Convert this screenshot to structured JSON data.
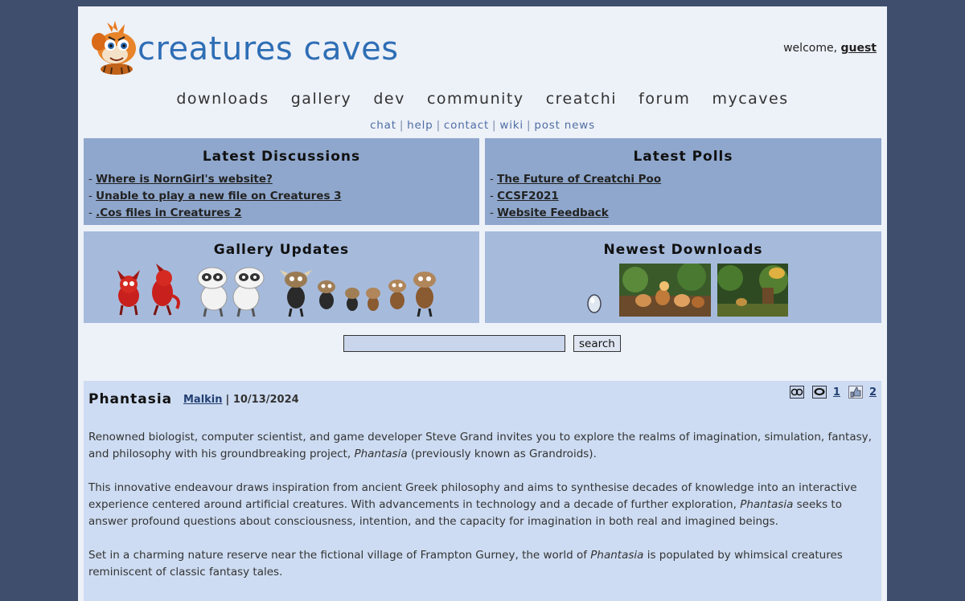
{
  "header": {
    "logo_text": "creatures caves",
    "welcome_prefix": "welcome,",
    "welcome_user": "guest"
  },
  "mainnav": [
    "downloads",
    "gallery",
    "dev",
    "community",
    "creatchi",
    "forum",
    "mycaves"
  ],
  "subnav": [
    "chat",
    "help",
    "contact",
    "wiki",
    "post news"
  ],
  "latest_discussions": {
    "title": "Latest Discussions",
    "items": [
      "Where is NornGirl's website?",
      "Unable to play a new file on Creatures 3",
      ".Cos files in Creatures 2"
    ]
  },
  "latest_polls": {
    "title": "Latest Polls",
    "items": [
      "The Future of Creatchi Poo",
      "CCSF2021",
      "Website Feedback"
    ]
  },
  "gallery_updates": {
    "title": "Gallery Updates"
  },
  "newest_downloads": {
    "title": "Newest Downloads"
  },
  "search": {
    "button_label": "search",
    "value": ""
  },
  "article": {
    "title": "Phantasia",
    "author": "Malkin",
    "date": "10/13/2024",
    "comments_count": "1",
    "likes_count": "2",
    "p1_a": "Renowned biologist, computer scientist, and game developer Steve Grand invites you to explore the realms of imagination, simulation, fantasy, and philosophy with his groundbreaking project, ",
    "p1_em": "Phantasia",
    "p1_b": " (previously known as Grandroids).",
    "p2_a": "This innovative endeavour draws inspiration from ancient Greek philosophy and aims to synthesise decades of knowledge into an interactive experience centered around artificial creatures. With advancements in technology and a decade of further exploration, ",
    "p2_em": "Phantasia",
    "p2_b": " seeks to answer profound questions about consciousness, intention, and the capacity for imagination in both real and imagined beings.",
    "p3_a": "Set in a charming nature reserve near the fictional village of Frampton Gurney, the world of ",
    "p3_em": "Phantasia",
    "p3_b": " is populated by whimsical creatures reminiscent of classic fantasy tales."
  },
  "colors": {
    "background": "#3e4e6c",
    "page": "#edf1f8",
    "box_dark": "#8fa7cc",
    "box_light": "#a6bbdc",
    "article": "#cddcf2",
    "logo": "#2e6eb5"
  }
}
